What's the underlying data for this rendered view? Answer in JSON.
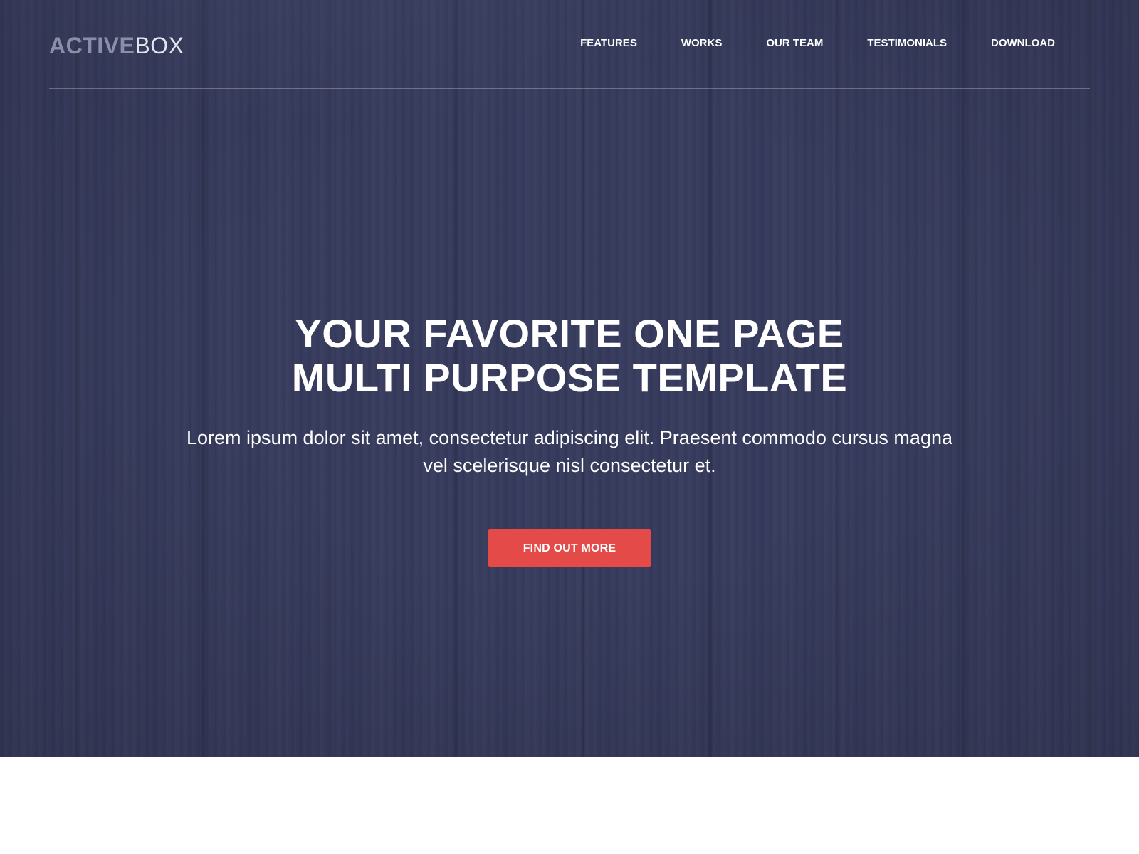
{
  "brand": {
    "logo_strong": "ACTIVE",
    "logo_light": "BOX"
  },
  "nav": {
    "items": [
      {
        "label": "FEATURES"
      },
      {
        "label": "WORKS"
      },
      {
        "label": "OUR TEAM"
      },
      {
        "label": "TESTIMONIALS"
      },
      {
        "label": "DOWNLOAD"
      }
    ]
  },
  "hero": {
    "headline_line1": "YOUR FAVORITE ONE PAGE",
    "headline_line2": "MULTI PURPOSE TEMPLATE",
    "subtext_line1": "Lorem ipsum dolor sit amet, consectetur adipiscing elit. Praesent commodo cursus magna",
    "subtext_line2": "vel scelerisque nisl consectetur et.",
    "cta_label": "FIND OUT MORE"
  },
  "colors": {
    "hero_background": "#363a5c",
    "cta_background": "#e34a48",
    "logo_strong": "#8a8ea8",
    "text": "#ffffff"
  }
}
